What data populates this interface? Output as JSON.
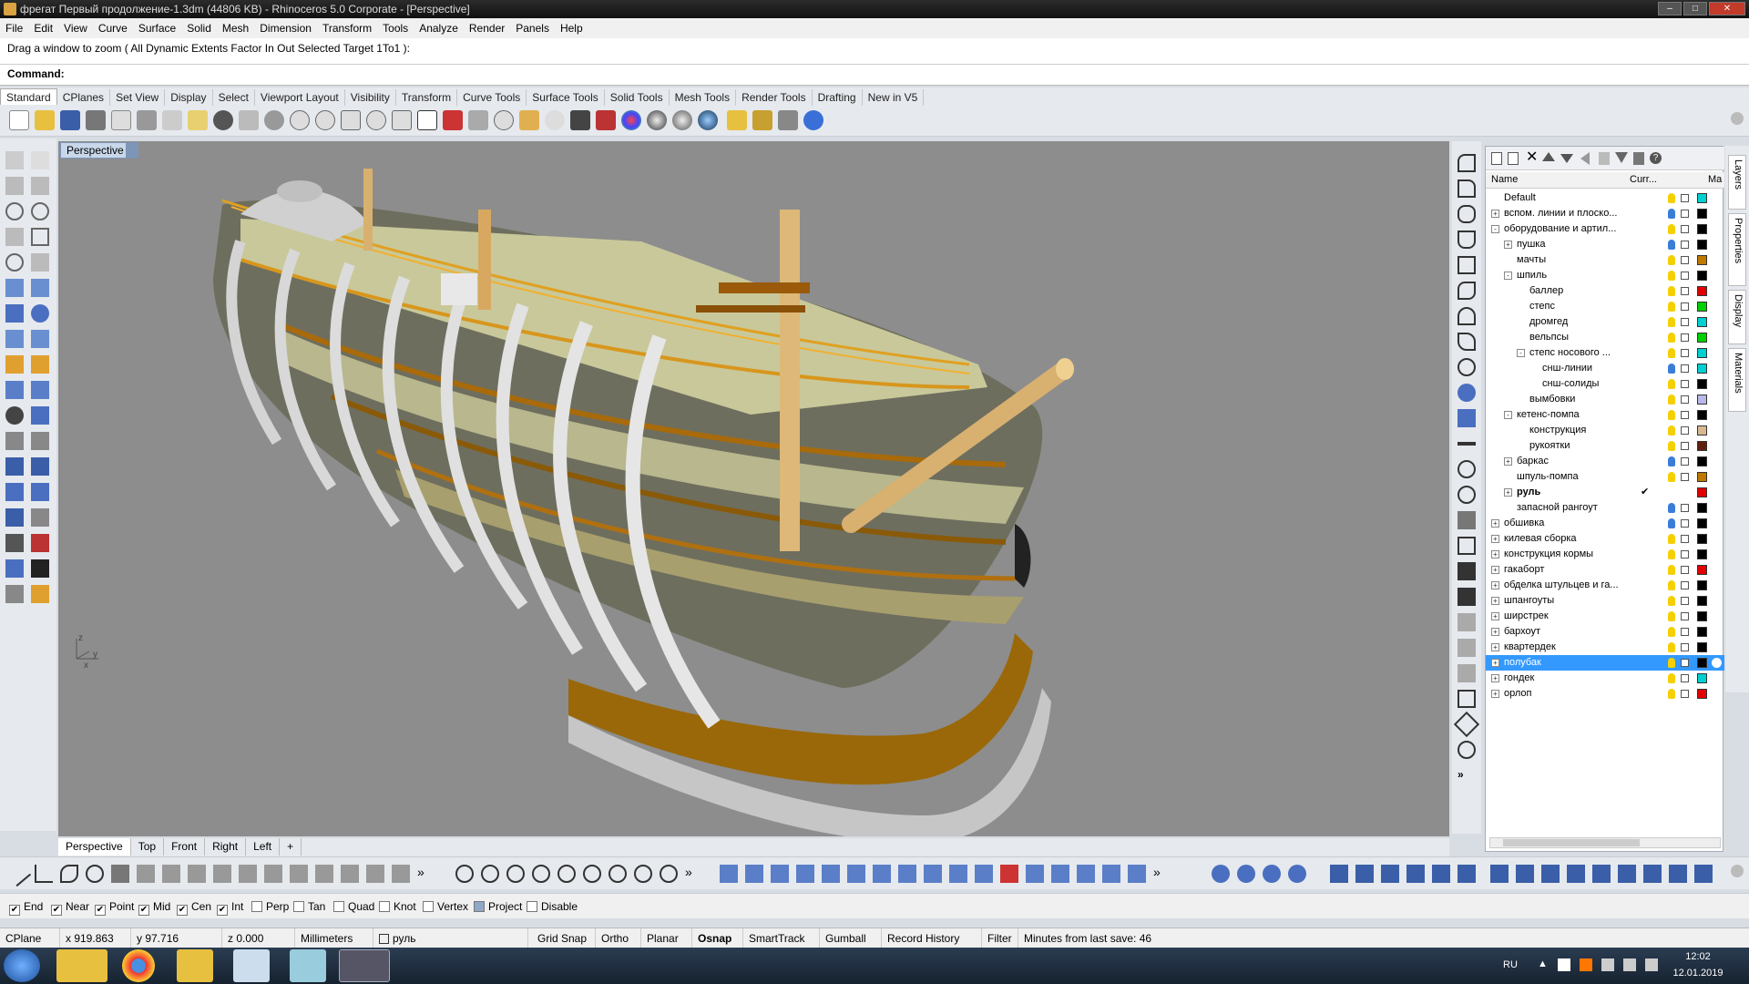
{
  "window": {
    "title": "фрегат Первый продолжение-1.3dm (44806 KB) - Rhinoceros  5.0 Corporate - [Perspective]"
  },
  "menu": [
    "File",
    "Edit",
    "View",
    "Curve",
    "Surface",
    "Solid",
    "Mesh",
    "Dimension",
    "Transform",
    "Tools",
    "Analyze",
    "Render",
    "Panels",
    "Help"
  ],
  "command": {
    "history": "Drag a window to zoom ( All  Dynamic  Extents  Factor  In  Out  Selected  Target  1To1 ):",
    "prompt": "Command:"
  },
  "toolbar_tabs": [
    "Standard",
    "CPlanes",
    "Set View",
    "Display",
    "Select",
    "Viewport Layout",
    "Visibility",
    "Transform",
    "Curve Tools",
    "Surface Tools",
    "Solid Tools",
    "Mesh Tools",
    "Render Tools",
    "Drafting",
    "New in V5"
  ],
  "viewport": {
    "active_label": "Perspective",
    "tabs": [
      "Perspective",
      "Top",
      "Front",
      "Right",
      "Left"
    ],
    "add_tab": "+",
    "axis_z": "z",
    "axis_y": "y",
    "axis_x": "x"
  },
  "layers": {
    "header_name": "Name",
    "header_current": "Curr...",
    "header_material": "Ma",
    "rows": [
      {
        "name": "Default",
        "indent": 0,
        "exp": "",
        "bulb": "#f5d000",
        "color": "#00d0d0"
      },
      {
        "name": "вспом. линии и плоско...",
        "indent": 0,
        "exp": "+",
        "bulb": "#3a7dd8",
        "color": "#000000"
      },
      {
        "name": "оборудование и артил...",
        "indent": 0,
        "exp": "-",
        "bulb": "#f5d000",
        "color": "#000000"
      },
      {
        "name": "пушка",
        "indent": 1,
        "exp": "+",
        "bulb": "#3a7dd8",
        "color": "#000000"
      },
      {
        "name": "мачты",
        "indent": 1,
        "exp": "",
        "bulb": "#f5d000",
        "color": "#c07800"
      },
      {
        "name": "шпиль",
        "indent": 1,
        "exp": "-",
        "bulb": "#f5d000",
        "color": "#000000"
      },
      {
        "name": "баллер",
        "indent": 2,
        "exp": "",
        "bulb": "#f5d000",
        "color": "#e00000"
      },
      {
        "name": "степс",
        "indent": 2,
        "exp": "",
        "bulb": "#f5d000",
        "color": "#00d000"
      },
      {
        "name": "дромгед",
        "indent": 2,
        "exp": "",
        "bulb": "#f5d000",
        "color": "#00d0d0"
      },
      {
        "name": "вельпсы",
        "indent": 2,
        "exp": "",
        "bulb": "#f5d000",
        "color": "#00d000"
      },
      {
        "name": "степс носового ...",
        "indent": 2,
        "exp": "-",
        "bulb": "#f5d000",
        "color": "#00d0d0"
      },
      {
        "name": "снш-линии",
        "indent": 3,
        "exp": "",
        "bulb": "#3a7dd8",
        "color": "#00d0d0"
      },
      {
        "name": "снш-солиды",
        "indent": 3,
        "exp": "",
        "bulb": "#f5d000",
        "color": "#000000"
      },
      {
        "name": "вымбовки",
        "indent": 2,
        "exp": "",
        "bulb": "#f5d000",
        "color": "#b8b8e8"
      },
      {
        "name": "кетенс-помпа",
        "indent": 1,
        "exp": "-",
        "bulb": "#f5d000",
        "color": "#000000"
      },
      {
        "name": "конструкция",
        "indent": 2,
        "exp": "",
        "bulb": "#f5d000",
        "color": "#d8b890"
      },
      {
        "name": "рукоятки",
        "indent": 2,
        "exp": "",
        "bulb": "#f5d000",
        "color": "#602010"
      },
      {
        "name": "баркас",
        "indent": 1,
        "exp": "+",
        "bulb": "#3a7dd8",
        "color": "#000000"
      },
      {
        "name": "шпуль-помпа",
        "indent": 1,
        "exp": "",
        "bulb": "#f5d000",
        "color": "#c07800"
      },
      {
        "name": "руль",
        "indent": 1,
        "exp": "+",
        "bulb": "",
        "color": "#e00000",
        "bold": true,
        "current": "✔"
      },
      {
        "name": "запасной рангоут",
        "indent": 1,
        "exp": "",
        "bulb": "#3a7dd8",
        "color": "#000000"
      },
      {
        "name": "обшивка",
        "indent": 0,
        "exp": "+",
        "bulb": "#3a7dd8",
        "color": "#000000"
      },
      {
        "name": "килевая сборка",
        "indent": 0,
        "exp": "+",
        "bulb": "#f5d000",
        "color": "#000000"
      },
      {
        "name": "конструкция кормы",
        "indent": 0,
        "exp": "+",
        "bulb": "#f5d000",
        "color": "#000000"
      },
      {
        "name": "гакаборт",
        "indent": 0,
        "exp": "+",
        "bulb": "#f5d000",
        "color": "#e00000"
      },
      {
        "name": "обделка штульцев и га...",
        "indent": 0,
        "exp": "+",
        "bulb": "#f5d000",
        "color": "#000000"
      },
      {
        "name": "шпангоуты",
        "indent": 0,
        "exp": "+",
        "bulb": "#f5d000",
        "color": "#000000"
      },
      {
        "name": "ширстрек",
        "indent": 0,
        "exp": "+",
        "bulb": "#f5d000",
        "color": "#000000"
      },
      {
        "name": "бархоут",
        "indent": 0,
        "exp": "+",
        "bulb": "#f5d000",
        "color": "#000000"
      },
      {
        "name": "квартердек",
        "indent": 0,
        "exp": "+",
        "bulb": "#f5d000",
        "color": "#000000"
      },
      {
        "name": "полубак",
        "indent": 0,
        "exp": "+",
        "bulb": "#f5d000",
        "color": "#000000",
        "selected": true
      },
      {
        "name": "гондек",
        "indent": 0,
        "exp": "+",
        "bulb": "#f5d000",
        "color": "#00d0d0"
      },
      {
        "name": "орлоп",
        "indent": 0,
        "exp": "+",
        "bulb": "#f5d000",
        "color": "#e00000"
      }
    ]
  },
  "panel_tabs": [
    "Layers",
    "Properties",
    "Display",
    "Materials"
  ],
  "osnap": {
    "items": [
      {
        "label": "End",
        "checked": true
      },
      {
        "label": "Near",
        "checked": true
      },
      {
        "label": "Point",
        "checked": true
      },
      {
        "label": "Mid",
        "checked": true
      },
      {
        "label": "Cen",
        "checked": true
      },
      {
        "label": "Int",
        "checked": true
      },
      {
        "label": "Perp",
        "checked": false
      },
      {
        "label": "Tan",
        "checked": false
      },
      {
        "label": "Quad",
        "checked": false
      },
      {
        "label": "Knot",
        "checked": false
      },
      {
        "label": "Vertex",
        "checked": false
      },
      {
        "label": "Project",
        "checked": false
      },
      {
        "label": "Disable",
        "checked": false
      }
    ]
  },
  "status": {
    "cplane": "CPlane",
    "x": "x 919.863",
    "y": "y 97.716",
    "z": "z 0.000",
    "units": "Millimeters",
    "layer": "руль",
    "grid_snap": "Grid Snap",
    "ortho": "Ortho",
    "planar": "Planar",
    "osnap": "Osnap",
    "smarttrack": "SmartTrack",
    "gumball": "Gumball",
    "record_history": "Record History",
    "filter": "Filter",
    "save_msg": "Minutes from last save: 46"
  },
  "taskbar": {
    "lang": "RU",
    "time": "12:02",
    "date": "12.01.2019"
  }
}
